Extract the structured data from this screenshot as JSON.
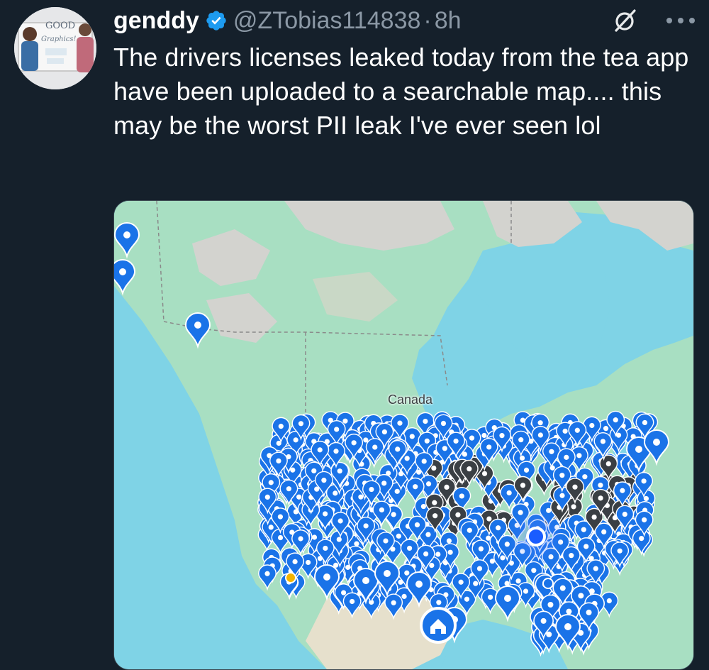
{
  "author": {
    "display_name": "genddy",
    "handle": "@ZTobias114838",
    "separator": "·",
    "time": "8h",
    "avatar_text_top": "GOOD",
    "avatar_text_bottom": "Graphics!"
  },
  "tweet": {
    "text": "The drivers licenses leaked today from the tea app have been uploaded to a searchable map.... this may be the worst PII leak I've ever seen lol"
  },
  "map": {
    "label": "Canada"
  },
  "colors": {
    "background": "#15202b",
    "verified_blue": "#1d9bf0",
    "muted_text": "#8b98a5",
    "pin_blue": "#1a73e8",
    "water": "#7fd3e6",
    "land_green": "#a8dfc2"
  },
  "icons": {
    "verified": "verified-badge-icon",
    "grok": "grok-icon",
    "more": "more-options-icon",
    "pin": "map-pin-icon",
    "home": "home-icon",
    "location": "current-location-icon"
  }
}
